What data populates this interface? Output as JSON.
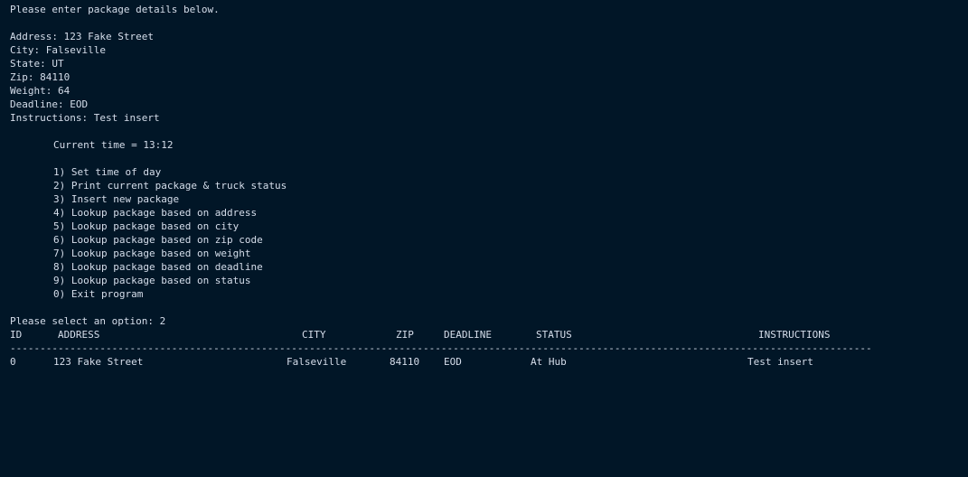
{
  "prompt": "Please enter package details below.",
  "package_details": {
    "address": "Address: 123 Fake Street",
    "city": "City: Falseville",
    "state": "State: UT",
    "zip": "Zip: 84110",
    "weight": "Weight: 64",
    "deadline": "Deadline: EOD",
    "instructions": "Instructions: Test insert"
  },
  "current_time": "Current time = 13:12",
  "menu": [
    "1) Set time of day",
    "2) Print current package & truck status",
    "3) Insert new package",
    "4) Lookup package based on address",
    "5) Lookup package based on city",
    "6) Lookup package based on zip code",
    "7) Lookup package based on weight",
    "8) Lookup package based on deadline",
    "9) Lookup package based on status",
    "0) Exit program"
  ],
  "select_prompt": "Please select an option: 2",
  "table": {
    "headers": {
      "id": "ID",
      "address": "ADDRESS",
      "city": "CITY",
      "zip": "ZIP",
      "deadline": "DEADLINE",
      "status": "STATUS",
      "instructions": "INSTRUCTIONS"
    },
    "divider": "--------------------------------------------------------------------------------------------------------------------------------------------------------------",
    "rows": [
      {
        "id": "0",
        "address": "123 Fake Street",
        "city": "Falseville",
        "zip": "84110",
        "deadline": "EOD",
        "status": "At Hub",
        "instructions": "Test insert"
      }
    ]
  }
}
